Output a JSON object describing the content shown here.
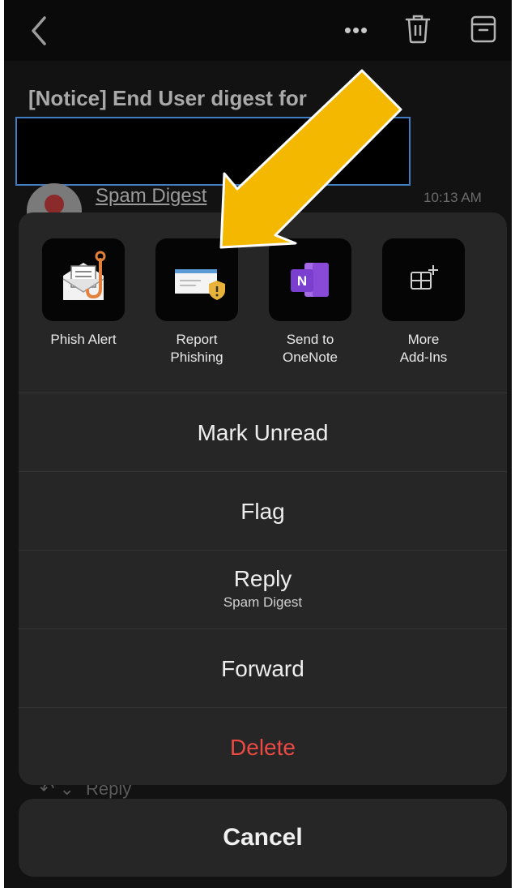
{
  "colors": {
    "background": "#121212",
    "sheet": "#262626",
    "accent_arrow": "#f5b800",
    "danger": "#ea4a43",
    "onenote": "#7b3fd0",
    "highlight_box": "#3f7cc0"
  },
  "toolbar": {
    "back_icon": "chevron-left-icon",
    "more_label": "•••",
    "more_icon": "more-icon",
    "trash_icon": "trash-icon",
    "archive_icon": "archive-icon"
  },
  "email": {
    "subject": "[Notice] End User digest for",
    "sender": "Spam Digest",
    "time": "10:13 AM",
    "reply_hint": "Reply"
  },
  "addins": [
    {
      "label": "Phish Alert",
      "icon": "phish-alert-hook-envelope-icon"
    },
    {
      "label": "Report\nPhishing",
      "icon": "report-phishing-envelope-shield-icon"
    },
    {
      "label": "Send to\nOneNote",
      "icon": "onenote-icon"
    },
    {
      "label": "More\nAdd-Ins",
      "icon": "add-ins-grid-plus-icon"
    }
  ],
  "actions": {
    "mark_unread": "Mark Unread",
    "flag": "Flag",
    "reply": "Reply",
    "reply_sub": "Spam Digest",
    "forward": "Forward",
    "delete": "Delete"
  },
  "cancel_label": "Cancel",
  "annotation": {
    "icon": "pointing-arrow-icon"
  }
}
